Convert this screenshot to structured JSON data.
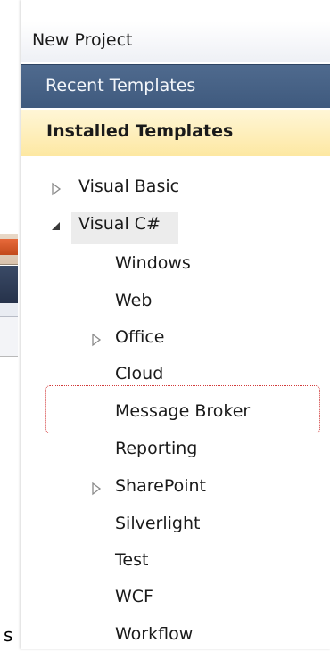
{
  "dialog": {
    "title": "New Project",
    "recent_label": "Recent Templates",
    "installed_label": "Installed Templates"
  },
  "tree": {
    "visual_basic": "Visual Basic",
    "visual_csharp": "Visual C#",
    "children": [
      "Windows",
      "Web",
      "Office",
      "Cloud",
      "Message Broker",
      "Reporting",
      "SharePoint",
      "Silverlight",
      "Test",
      "WCF",
      "Workflow"
    ]
  },
  "background": {
    "partial_glyph": "s"
  }
}
